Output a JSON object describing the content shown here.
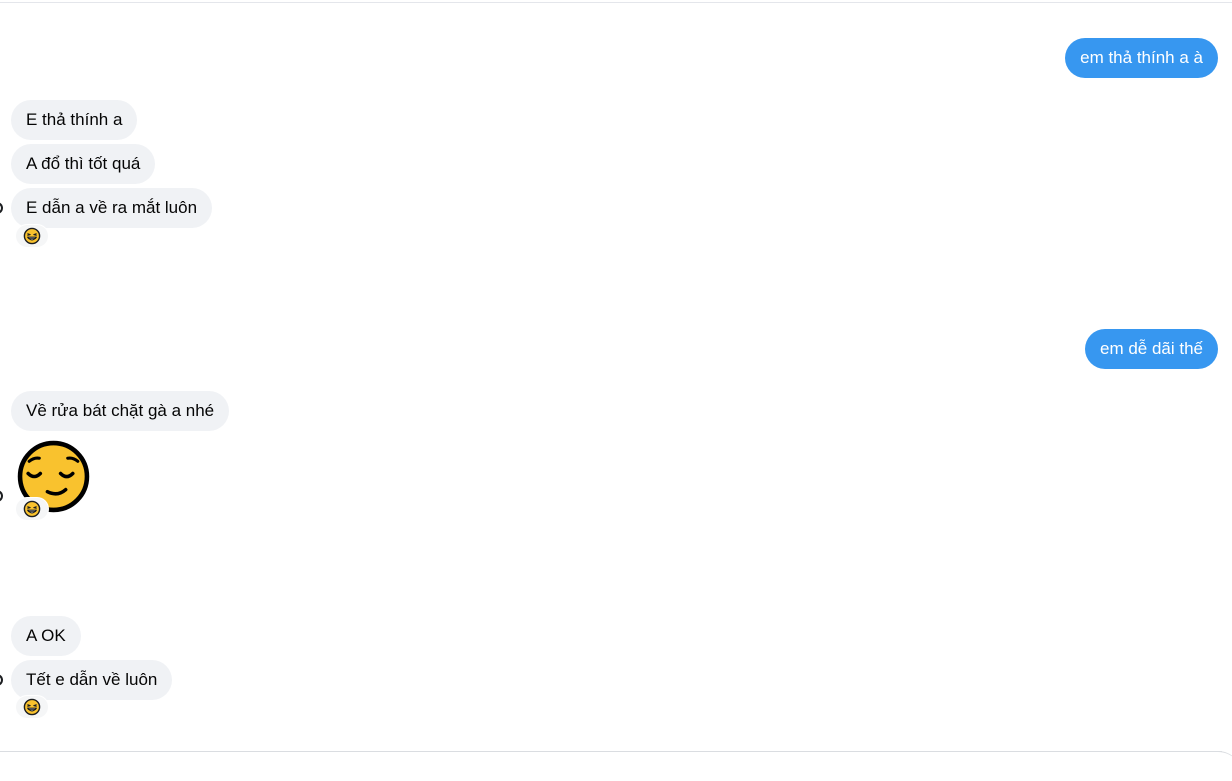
{
  "messages": [
    {
      "id": "m1",
      "direction": "outgoing",
      "text": "em thả thính a à"
    },
    {
      "id": "m2",
      "direction": "incoming",
      "text": "E thả thính a"
    },
    {
      "id": "m3",
      "direction": "incoming",
      "text": "A đổ thì tốt quá"
    },
    {
      "id": "m4",
      "direction": "incoming",
      "text": "E dẫn a về ra mắt luôn",
      "reaction": "laughing-emoji"
    },
    {
      "id": "m5",
      "direction": "outgoing",
      "text": "em dễ dãi thế"
    },
    {
      "id": "m6",
      "direction": "incoming",
      "text": "Về rửa bát chặt gà a nhé"
    },
    {
      "id": "m7",
      "direction": "incoming",
      "emoji": "relieved-face",
      "reaction": "laughing-emoji"
    },
    {
      "id": "m8",
      "direction": "incoming",
      "text": "A OK"
    },
    {
      "id": "m9",
      "direction": "incoming",
      "text": "Tết e dẫn về luôn",
      "reaction": "laughing-emoji"
    }
  ],
  "colors": {
    "outgoing_bubble": "#3797f0",
    "incoming_bubble": "#f0f2f5",
    "emoji_yellow": "#f9c22e",
    "outline": "#1c1e21"
  }
}
